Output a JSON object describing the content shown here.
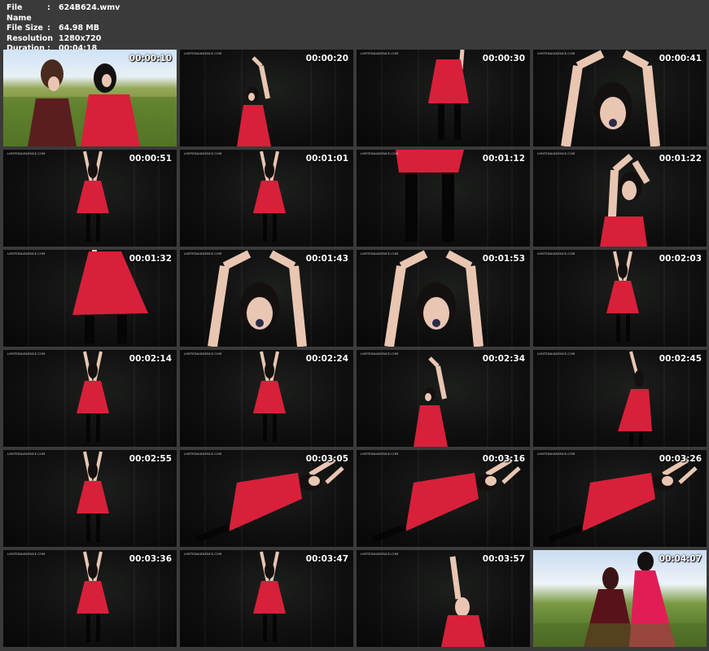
{
  "header": {
    "rows": [
      {
        "label": "File Name",
        "value": "624B624.wmv"
      },
      {
        "label": "File Size",
        "value": "64.98 MB"
      },
      {
        "label": "Resolution",
        "value": "1280x720"
      },
      {
        "label": "Duration",
        "value": "00:04:18"
      }
    ],
    "colon": ":"
  },
  "watermark": "LIMITEDAUDIENCE.COM",
  "thumbnails": [
    {
      "time": "00:00:10",
      "scene": "outdoor"
    },
    {
      "time": "00:00:20",
      "scene": "raised-left"
    },
    {
      "time": "00:00:30",
      "scene": "skirt-center"
    },
    {
      "time": "00:00:41",
      "scene": "closeup-arms"
    },
    {
      "time": "00:00:51",
      "scene": "standing"
    },
    {
      "time": "00:01:01",
      "scene": "standing"
    },
    {
      "time": "00:01:12",
      "scene": "skirt-legs"
    },
    {
      "time": "00:01:22",
      "scene": "closeup-right"
    },
    {
      "time": "00:01:32",
      "scene": "skirt-large"
    },
    {
      "time": "00:01:43",
      "scene": "closeup-arms"
    },
    {
      "time": "00:01:53",
      "scene": "closeup-arms"
    },
    {
      "time": "00:02:03",
      "scene": "standing"
    },
    {
      "time": "00:02:14",
      "scene": "standing"
    },
    {
      "time": "00:02:24",
      "scene": "standing"
    },
    {
      "time": "00:02:34",
      "scene": "raised-left"
    },
    {
      "time": "00:02:45",
      "scene": "standing-right"
    },
    {
      "time": "00:02:55",
      "scene": "standing"
    },
    {
      "time": "00:03:05",
      "scene": "leaning"
    },
    {
      "time": "00:03:16",
      "scene": "leaning"
    },
    {
      "time": "00:03:26",
      "scene": "leaning"
    },
    {
      "time": "00:03:36",
      "scene": "standing"
    },
    {
      "time": "00:03:47",
      "scene": "standing"
    },
    {
      "time": "00:03:57",
      "scene": "raised-right"
    },
    {
      "time": "00:04:07",
      "scene": "outdoor2"
    }
  ],
  "colors": {
    "background": "#3a3a3a",
    "header_text": "#ffffff",
    "dress": "#d8203a",
    "dress_dark": "#a3122a",
    "skin": "#e9c6b2",
    "hair": "#141010"
  }
}
